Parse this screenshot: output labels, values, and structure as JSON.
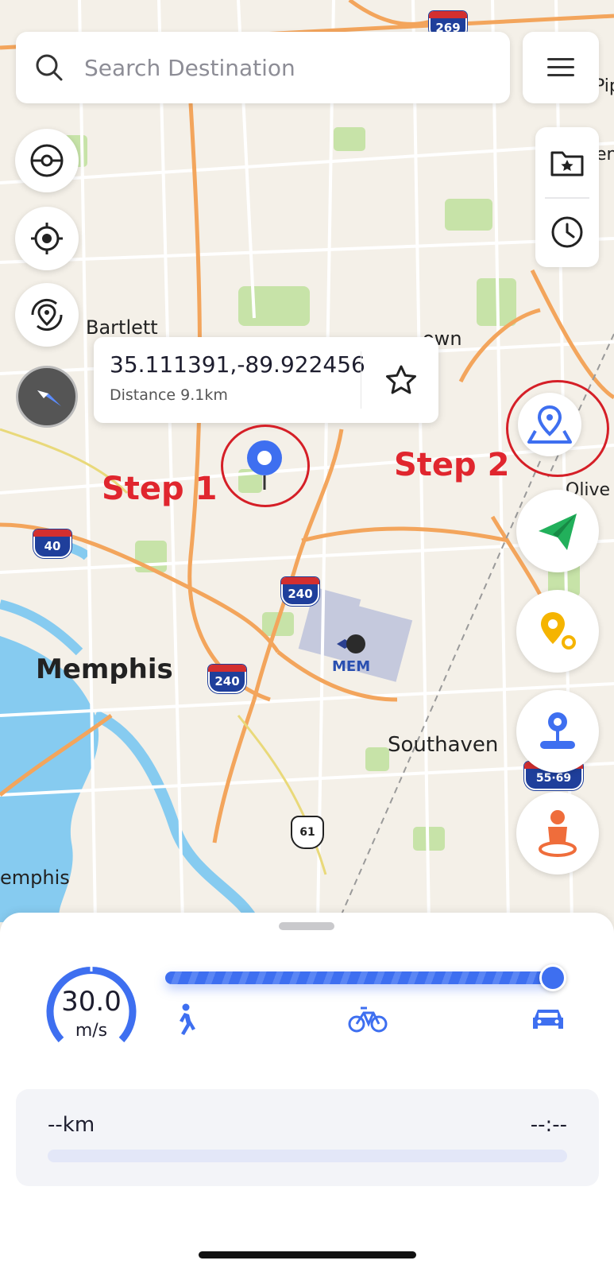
{
  "search": {
    "placeholder": "Search Destination"
  },
  "map": {
    "labels": {
      "bartlett": "Bartlett",
      "germantown_partial": "own",
      "memphis": "Memphis",
      "memphis_edge": "emphis",
      "southaven": "Southaven",
      "olive_partial": "Olive",
      "pip_partial": "Pip",
      "en_partial": "en",
      "airport": "MEM"
    },
    "shields": {
      "i40": "40",
      "i240_north": "240",
      "i240_south": "240",
      "i269": "269",
      "i55_69": "55·69",
      "us61": "61"
    }
  },
  "location_popup": {
    "coordinates": "35.111391,-89.922456",
    "distance": "Distance 9.1km"
  },
  "annotations": {
    "step1": "Step 1",
    "step2": "Step 2"
  },
  "colors": {
    "accent": "#3e6ff0",
    "annotation_red": "#d51f27",
    "send_green": "#22b05b",
    "marker_yellow": "#f5b400",
    "person_orange": "#ef6d3b"
  },
  "speed": {
    "value": "30.0",
    "unit": "m/s",
    "slider_fraction": 1.0,
    "modes": [
      "walk-icon",
      "bike-icon",
      "car-icon"
    ]
  },
  "trip": {
    "distance": "--km",
    "time": "--:--"
  }
}
